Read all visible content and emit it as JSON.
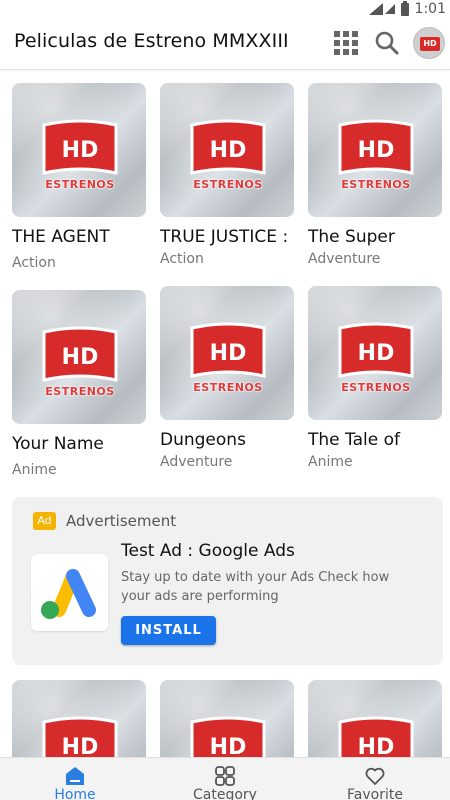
{
  "status": {
    "time": "1:01"
  },
  "appbar": {
    "title": "Peliculas de Estreno MMXXIII",
    "icons": [
      "grid-icon",
      "search-icon",
      "avatar"
    ],
    "avatar_text": "HD"
  },
  "thumb_text": {
    "hd": "HD",
    "estrenos": "ESTRENOS"
  },
  "movies_row1": [
    {
      "title": "THE AGENT",
      "category": "Action"
    },
    {
      "title": "TRUE JUSTICE :",
      "category": "Action"
    },
    {
      "title": "The Super",
      "category": "Adventure"
    }
  ],
  "movies_row2": [
    {
      "title": "Your Name",
      "category": "Anime"
    },
    {
      "title": "Dungeons",
      "category": "Adventure"
    },
    {
      "title": "The Tale of",
      "category": "Anime"
    }
  ],
  "ad": {
    "badge": "Ad",
    "label": "Advertisement",
    "title": "Test Ad : Google Ads",
    "description": "Stay up to date with your Ads Check how your ads are performing",
    "cta": "INSTALL"
  },
  "bottom_nav": [
    {
      "label": "Home",
      "icon": "home-icon",
      "active": true
    },
    {
      "label": "Category",
      "icon": "category-icon",
      "active": false
    },
    {
      "label": "Favorite",
      "icon": "heart-icon",
      "active": false
    }
  ],
  "colors": {
    "accent": "#2a7de1",
    "install": "#1a73e8",
    "hd_red": "#d72b2b",
    "ad_badge": "#f4b400"
  }
}
